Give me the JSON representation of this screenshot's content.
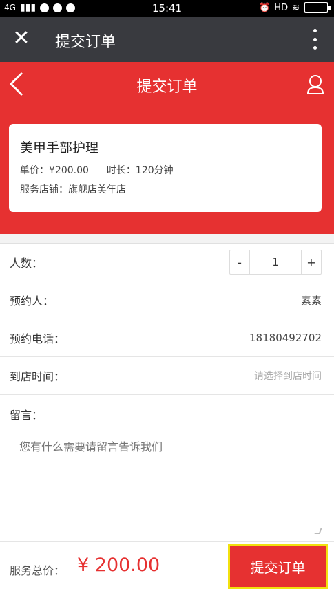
{
  "status_bar": {
    "network": "4G",
    "time": "15:41",
    "hd": "HD"
  },
  "wechat_bar": {
    "title": "提交订单"
  },
  "header": {
    "title": "提交订单"
  },
  "product": {
    "name": "美甲手部护理",
    "price_label": "单价：¥200.00",
    "duration_label": "时长：120分钟",
    "store_label": "服务店铺：旗舰店美年店"
  },
  "form": {
    "people_label": "人数：",
    "quantity": "1",
    "minus": "-",
    "plus": "+",
    "booker_label": "预约人：",
    "booker_value": "素素",
    "phone_label": "预约电话：",
    "phone_value": "18180492702",
    "time_label": "到店时间：",
    "time_placeholder": "请选择到店时间",
    "message_label": "留言：",
    "message_placeholder": "您有什么需要请留言告诉我们"
  },
  "footer": {
    "total_label": "服务总价：",
    "total_value": "¥ 200.00",
    "submit_label": "提交订单"
  },
  "colors": {
    "accent": "#e63131",
    "wechat_bar": "#393a3f",
    "highlight": "#f2e10f"
  }
}
